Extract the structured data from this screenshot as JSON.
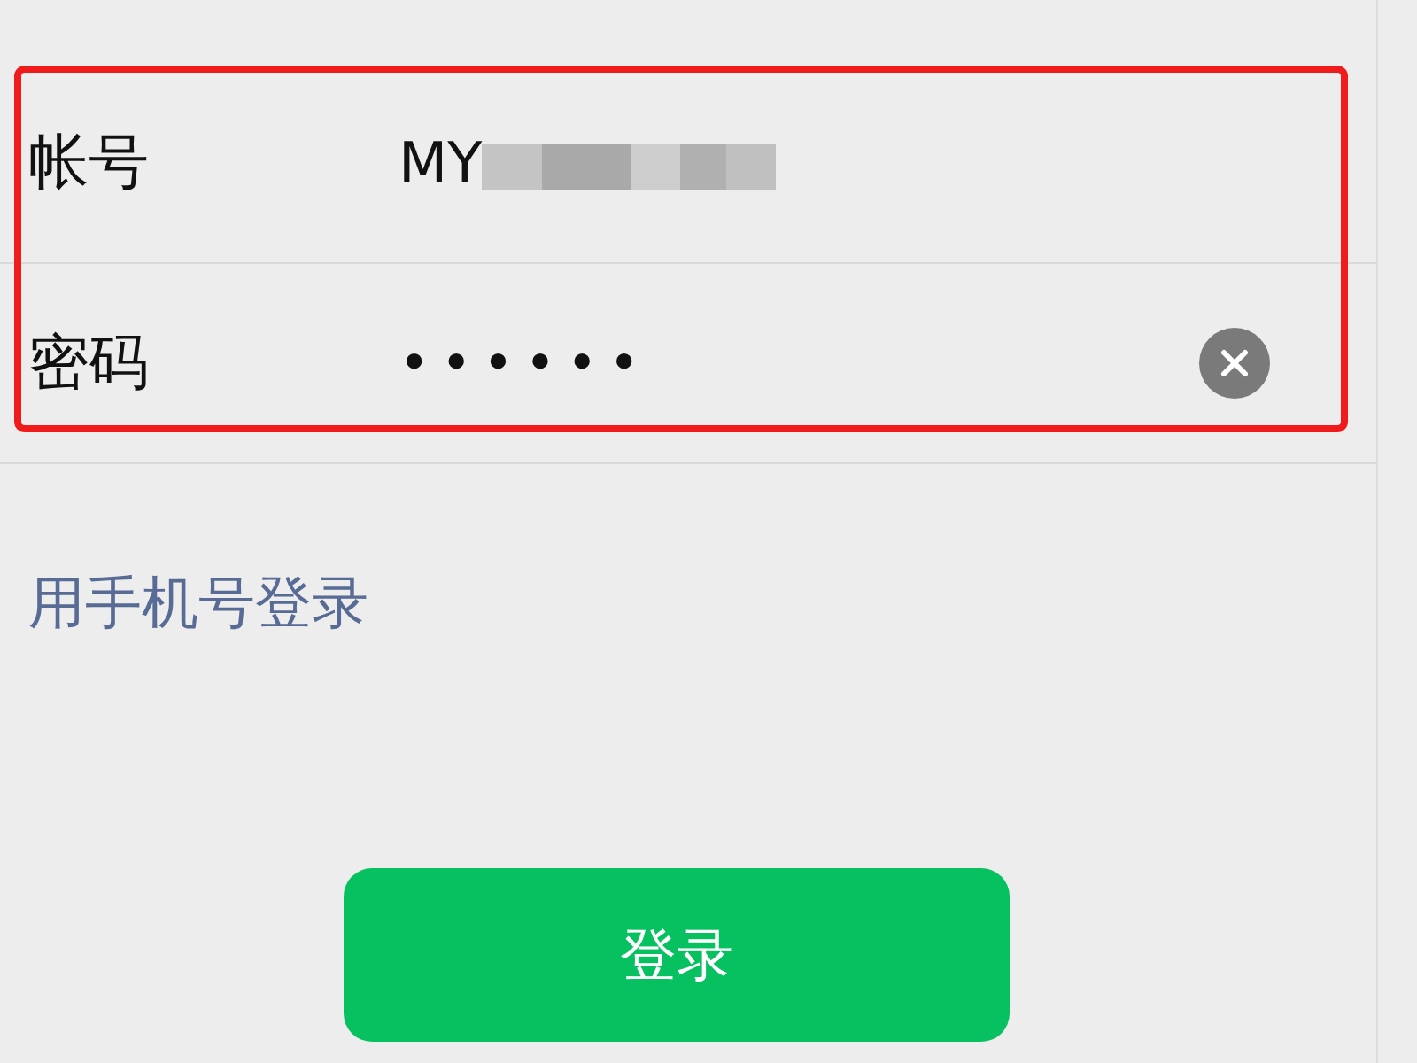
{
  "form": {
    "fields": [
      {
        "kind": "text",
        "label": "帐号",
        "value": "MY"
      },
      {
        "kind": "password",
        "label": "密码",
        "value": "••••••"
      }
    ]
  },
  "phone_login_link": "用手机号登录",
  "login_button": "登录"
}
